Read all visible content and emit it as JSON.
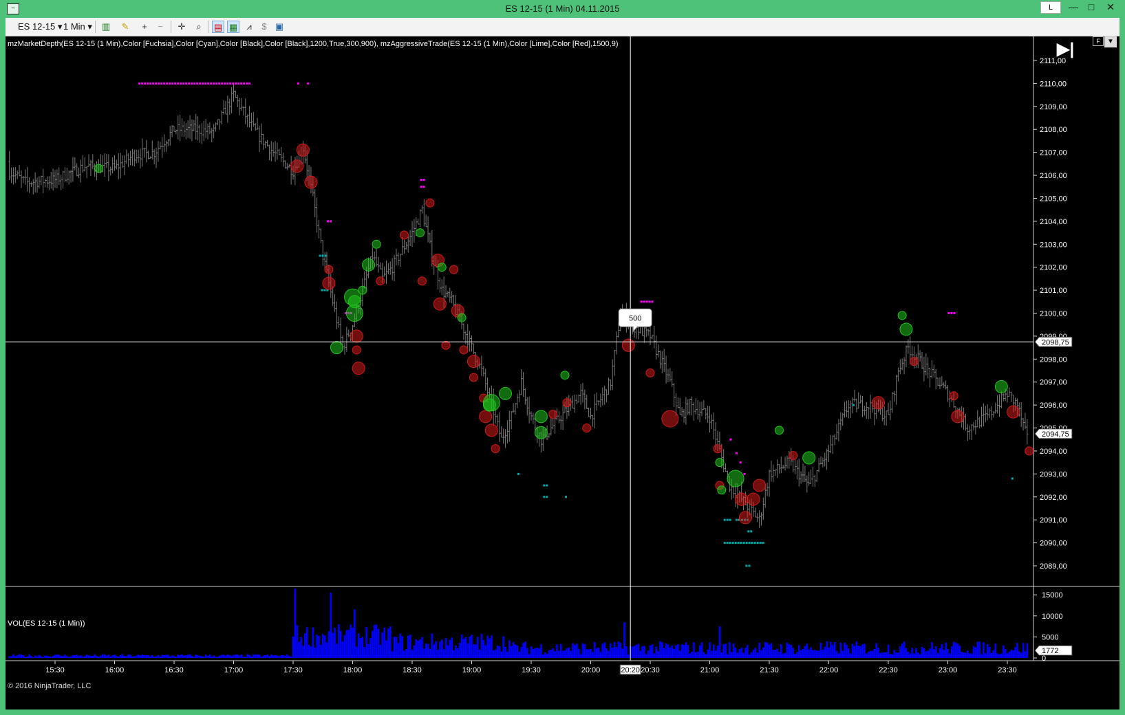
{
  "window": {
    "title": "ES 12-15 (1 Min)  04.11.2015",
    "l_button": "L",
    "minimize": "—",
    "maximize": "□",
    "close": "✕"
  },
  "toolbar": {
    "instrument": "ES 12-15",
    "interval": "1 Min"
  },
  "chart": {
    "indicator_label": "mzMarketDepth(ES 12-15 (1 Min),Color [Fuchsia],Color [Cyan],Color [Black],Color [Black],1200,True,300,900), mzAggressiveTrade(ES 12-15 (1 Min),Color [Lime],Color [Red],1500,9)",
    "volume_label": "VOL(ES 12-15 (1 Min))",
    "copyright": "© 2016 NinjaTrader, LLC",
    "crosshair_price": "2098,75",
    "last_price": "2094,75",
    "last_volume": "1772",
    "crosshair_time": "20:20",
    "tooltip": "500",
    "f_button": "F",
    "colors": {
      "buy": "#21c21e",
      "sell": "#d01a1a",
      "depth_bid": "#ff00ff",
      "depth_ask": "#00c8c8",
      "volume": "#0000ff",
      "bars": "#7a7a7a"
    }
  },
  "chart_data": {
    "type": "ohlc",
    "instrument": "ES 12-15 (1 Min)",
    "price_axis": {
      "min": 2088.5,
      "max": 2111.5,
      "ticks": [
        "2111,00",
        "2110,00",
        "2109,00",
        "2108,00",
        "2107,00",
        "2106,00",
        "2105,00",
        "2104,00",
        "2103,00",
        "2102,00",
        "2101,00",
        "2100,00",
        "2099,00",
        "2098,00",
        "2097,00",
        "2096,00",
        "2095,00",
        "2094,00",
        "2093,00",
        "2092,00",
        "2091,00",
        "2090,00",
        "2089,00"
      ]
    },
    "volume_axis": {
      "min": 0,
      "max": 17000,
      "ticks": [
        "15000",
        "10000",
        "5000",
        "0"
      ]
    },
    "time_axis": [
      "15:30",
      "16:00",
      "16:30",
      "17:00",
      "17:30",
      "18:00",
      "18:30",
      "19:00",
      "19:30",
      "20:00",
      "20:30",
      "21:00",
      "21:30",
      "22:00",
      "22:30",
      "23:00",
      "23:30"
    ],
    "price_path": [
      [
        "15:00",
        2106.6
      ],
      [
        "15:15",
        2105.7
      ],
      [
        "15:30",
        2105.8
      ],
      [
        "15:45",
        2106.4
      ],
      [
        "16:00",
        2106.3
      ],
      [
        "16:10",
        2106.9
      ],
      [
        "16:20",
        2107.0
      ],
      [
        "16:30",
        2108.0
      ],
      [
        "16:40",
        2108.0
      ],
      [
        "16:50",
        2107.9
      ],
      [
        "17:00",
        2109.5
      ],
      [
        "17:10",
        2108.0
      ],
      [
        "17:20",
        2107.0
      ],
      [
        "17:30",
        2106.2
      ],
      [
        "17:35",
        2107.2
      ],
      [
        "17:40",
        2105.0
      ],
      [
        "17:45",
        2102.5
      ],
      [
        "17:50",
        2100.5
      ],
      [
        "17:55",
        2098.5
      ],
      [
        "18:00",
        2099.5
      ],
      [
        "18:05",
        2101.0
      ],
      [
        "18:10",
        2102.5
      ],
      [
        "18:15",
        2101.5
      ],
      [
        "18:20",
        2102.0
      ],
      [
        "18:30",
        2103.5
      ],
      [
        "18:35",
        2104.5
      ],
      [
        "18:40",
        2102.5
      ],
      [
        "18:45",
        2101.0
      ],
      [
        "18:50",
        2100.5
      ],
      [
        "19:00",
        2098.5
      ],
      [
        "19:05",
        2097.5
      ],
      [
        "19:10",
        2096.0
      ],
      [
        "19:15",
        2094.5
      ],
      [
        "19:20",
        2095.5
      ],
      [
        "19:25",
        2097.0
      ],
      [
        "19:30",
        2095.5
      ],
      [
        "19:35",
        2094.5
      ],
      [
        "19:45",
        2095.5
      ],
      [
        "19:55",
        2096.5
      ],
      [
        "20:00",
        2095.5
      ],
      [
        "20:10",
        2097.0
      ],
      [
        "20:15",
        2100.0
      ],
      [
        "20:20",
        2099.5
      ],
      [
        "20:30",
        2099.0
      ],
      [
        "20:40",
        2097.0
      ],
      [
        "20:45",
        2095.5
      ],
      [
        "20:50",
        2096.0
      ],
      [
        "21:00",
        2095.5
      ],
      [
        "21:05",
        2094.0
      ],
      [
        "21:10",
        2092.5
      ],
      [
        "21:15",
        2092.0
      ],
      [
        "21:20",
        2091.5
      ],
      [
        "21:25",
        2091.0
      ],
      [
        "21:30",
        2093.0
      ],
      [
        "21:40",
        2093.5
      ],
      [
        "21:50",
        2092.5
      ],
      [
        "22:00",
        2094.0
      ],
      [
        "22:10",
        2096.0
      ],
      [
        "22:20",
        2096.0
      ],
      [
        "22:30",
        2095.5
      ],
      [
        "22:35",
        2097.5
      ],
      [
        "22:40",
        2098.5
      ],
      [
        "22:50",
        2097.5
      ],
      [
        "23:00",
        2096.5
      ],
      [
        "23:10",
        2095.0
      ],
      [
        "23:20",
        2095.5
      ],
      [
        "23:30",
        2096.5
      ],
      [
        "23:35",
        2096.0
      ],
      [
        "23:40",
        2094.5
      ]
    ],
    "aggressive_trades": [
      {
        "t": "15:52",
        "p": 2106.3,
        "side": "buy",
        "size": 1
      },
      {
        "t": "17:32",
        "p": 2106.4,
        "side": "sell",
        "size": 2
      },
      {
        "t": "17:35",
        "p": 2107.1,
        "side": "sell",
        "size": 2
      },
      {
        "t": "17:39",
        "p": 2105.7,
        "side": "sell",
        "size": 2
      },
      {
        "t": "17:48",
        "p": 2101.9,
        "side": "sell",
        "size": 1
      },
      {
        "t": "17:48",
        "p": 2101.3,
        "side": "sell",
        "size": 2
      },
      {
        "t": "17:52",
        "p": 2098.5,
        "side": "buy",
        "size": 2
      },
      {
        "t": "18:00",
        "p": 2100.7,
        "side": "buy",
        "size": 3
      },
      {
        "t": "18:01",
        "p": 2100.5,
        "side": "buy",
        "size": 2
      },
      {
        "t": "18:01",
        "p": 2100.0,
        "side": "buy",
        "size": 3
      },
      {
        "t": "18:02",
        "p": 2099.0,
        "side": "sell",
        "size": 2
      },
      {
        "t": "18:02",
        "p": 2098.4,
        "side": "sell",
        "size": 1
      },
      {
        "t": "18:03",
        "p": 2097.6,
        "side": "sell",
        "size": 2
      },
      {
        "t": "18:05",
        "p": 2101.0,
        "side": "buy",
        "size": 1
      },
      {
        "t": "18:08",
        "p": 2102.1,
        "side": "buy",
        "size": 2
      },
      {
        "t": "18:12",
        "p": 2103.0,
        "side": "buy",
        "size": 1
      },
      {
        "t": "18:14",
        "p": 2101.4,
        "side": "sell",
        "size": 1
      },
      {
        "t": "18:26",
        "p": 2103.4,
        "side": "sell",
        "size": 1
      },
      {
        "t": "18:34",
        "p": 2103.5,
        "side": "buy",
        "size": 1
      },
      {
        "t": "18:35",
        "p": 2101.4,
        "side": "sell",
        "size": 1
      },
      {
        "t": "18:39",
        "p": 2104.8,
        "side": "sell",
        "size": 1
      },
      {
        "t": "18:43",
        "p": 2102.3,
        "side": "sell",
        "size": 2
      },
      {
        "t": "18:44",
        "p": 2100.4,
        "side": "sell",
        "size": 2
      },
      {
        "t": "18:45",
        "p": 2102.0,
        "side": "buy",
        "size": 1
      },
      {
        "t": "18:47",
        "p": 2098.6,
        "side": "sell",
        "size": 1
      },
      {
        "t": "18:51",
        "p": 2101.9,
        "side": "sell",
        "size": 1
      },
      {
        "t": "18:53",
        "p": 2100.1,
        "side": "sell",
        "size": 2
      },
      {
        "t": "18:55",
        "p": 2099.8,
        "side": "buy",
        "size": 1
      },
      {
        "t": "18:56",
        "p": 2098.4,
        "side": "sell",
        "size": 1
      },
      {
        "t": "19:01",
        "p": 2097.9,
        "side": "sell",
        "size": 2
      },
      {
        "t": "19:01",
        "p": 2097.2,
        "side": "sell",
        "size": 1
      },
      {
        "t": "19:06",
        "p": 2096.3,
        "side": "sell",
        "size": 1
      },
      {
        "t": "19:07",
        "p": 2095.5,
        "side": "sell",
        "size": 2
      },
      {
        "t": "19:09",
        "p": 2096.0,
        "side": "buy",
        "size": 2
      },
      {
        "t": "19:10",
        "p": 2096.1,
        "side": "buy",
        "size": 3
      },
      {
        "t": "19:10",
        "p": 2094.9,
        "side": "sell",
        "size": 2
      },
      {
        "t": "19:12",
        "p": 2094.1,
        "side": "sell",
        "size": 1
      },
      {
        "t": "19:17",
        "p": 2096.5,
        "side": "buy",
        "size": 2
      },
      {
        "t": "19:35",
        "p": 2095.5,
        "side": "buy",
        "size": 2
      },
      {
        "t": "19:35",
        "p": 2094.8,
        "side": "buy",
        "size": 2
      },
      {
        "t": "19:41",
        "p": 2095.6,
        "side": "sell",
        "size": 1
      },
      {
        "t": "19:47",
        "p": 2097.3,
        "side": "buy",
        "size": 1
      },
      {
        "t": "19:48",
        "p": 2096.1,
        "side": "sell",
        "size": 1
      },
      {
        "t": "19:58",
        "p": 2095.0,
        "side": "sell",
        "size": 1
      },
      {
        "t": "20:19",
        "p": 2098.6,
        "side": "sell",
        "size": 2
      },
      {
        "t": "20:30",
        "p": 2097.4,
        "side": "sell",
        "size": 1
      },
      {
        "t": "20:40",
        "p": 2095.4,
        "side": "sell",
        "size": 3
      },
      {
        "t": "21:04",
        "p": 2094.1,
        "side": "sell",
        "size": 1
      },
      {
        "t": "21:05",
        "p": 2093.5,
        "side": "buy",
        "size": 1
      },
      {
        "t": "21:05",
        "p": 2092.5,
        "side": "sell",
        "size": 1
      },
      {
        "t": "21:06",
        "p": 2092.3,
        "side": "buy",
        "size": 1
      },
      {
        "t": "21:13",
        "p": 2092.8,
        "side": "buy",
        "size": 3
      },
      {
        "t": "21:16",
        "p": 2091.9,
        "side": "sell",
        "size": 2
      },
      {
        "t": "21:18",
        "p": 2091.1,
        "side": "sell",
        "size": 2
      },
      {
        "t": "21:22",
        "p": 2091.9,
        "side": "sell",
        "size": 2
      },
      {
        "t": "21:25",
        "p": 2092.5,
        "side": "sell",
        "size": 2
      },
      {
        "t": "21:35",
        "p": 2094.9,
        "side": "buy",
        "size": 1
      },
      {
        "t": "21:42",
        "p": 2093.8,
        "side": "sell",
        "size": 1
      },
      {
        "t": "21:50",
        "p": 2093.7,
        "side": "buy",
        "size": 2
      },
      {
        "t": "22:25",
        "p": 2096.1,
        "side": "sell",
        "size": 2
      },
      {
        "t": "22:37",
        "p": 2099.9,
        "side": "buy",
        "size": 1
      },
      {
        "t": "22:39",
        "p": 2099.3,
        "side": "buy",
        "size": 2
      },
      {
        "t": "22:43",
        "p": 2097.9,
        "side": "sell",
        "size": 1
      },
      {
        "t": "23:03",
        "p": 2096.4,
        "side": "sell",
        "size": 1
      },
      {
        "t": "23:05",
        "p": 2095.5,
        "side": "sell",
        "size": 2
      },
      {
        "t": "23:27",
        "p": 2096.8,
        "side": "buy",
        "size": 2
      },
      {
        "t": "23:33",
        "p": 2095.7,
        "side": "sell",
        "size": 2
      },
      {
        "t": "23:41",
        "p": 2094.0,
        "side": "sell",
        "size": 1
      }
    ],
    "depth_bid": [
      {
        "t0": "16:12",
        "t1": "17:08",
        "p": 2110.0
      },
      {
        "t0": "17:32",
        "t1": "17:33",
        "p": 2110.0
      },
      {
        "t0": "17:37",
        "t1": "17:38",
        "p": 2110.0
      },
      {
        "t0": "18:34",
        "t1": "18:36",
        "p": 2105.8
      },
      {
        "t0": "18:34",
        "t1": "18:36",
        "p": 2105.5
      },
      {
        "t0": "17:47",
        "t1": "17:49",
        "p": 2104.0
      },
      {
        "t0": "17:56",
        "t1": "18:00",
        "p": 2100.0
      },
      {
        "t0": "20:25",
        "t1": "20:31",
        "p": 2100.5
      },
      {
        "t0": "21:10",
        "t1": "21:11",
        "p": 2094.5
      },
      {
        "t0": "21:13",
        "t1": "21:14",
        "p": 2093.9
      },
      {
        "t0": "21:15",
        "t1": "21:16",
        "p": 2093.5
      },
      {
        "t0": "21:17",
        "t1": "21:18",
        "p": 2093.0
      },
      {
        "t0": "23:00",
        "t1": "23:03",
        "p": 2100.0
      }
    ],
    "depth_ask": [
      {
        "t0": "17:43",
        "t1": "17:46",
        "p": 2102.5
      },
      {
        "t0": "17:44",
        "t1": "17:47",
        "p": 2101.0
      },
      {
        "t0": "19:23",
        "t1": "19:24",
        "p": 2093.0
      },
      {
        "t0": "19:36",
        "t1": "19:38",
        "p": 2092.5
      },
      {
        "t0": "19:36",
        "t1": "19:38",
        "p": 2092.0
      },
      {
        "t0": "19:47",
        "t1": "19:48",
        "p": 2092.0
      },
      {
        "t0": "21:07",
        "t1": "21:10",
        "p": 2091.0
      },
      {
        "t0": "21:13",
        "t1": "21:19",
        "p": 2091.0
      },
      {
        "t0": "21:07",
        "t1": "21:27",
        "p": 2090.0
      },
      {
        "t0": "21:18",
        "t1": "21:20",
        "p": 2089.0
      },
      {
        "t0": "21:19",
        "t1": "21:21",
        "p": 2090.5
      },
      {
        "t0": "22:12",
        "t1": "22:13",
        "p": 2096.0
      },
      {
        "t0": "23:32",
        "t1": "23:33",
        "p": 2092.8
      }
    ],
    "volume_spikes": [
      {
        "t": "17:31",
        "v": 16500
      },
      {
        "t": "17:49",
        "v": 15500
      },
      {
        "t": "18:01",
        "v": 11500
      },
      {
        "t": "20:17",
        "v": 8500
      },
      {
        "t": "21:05",
        "v": 7500
      }
    ]
  }
}
